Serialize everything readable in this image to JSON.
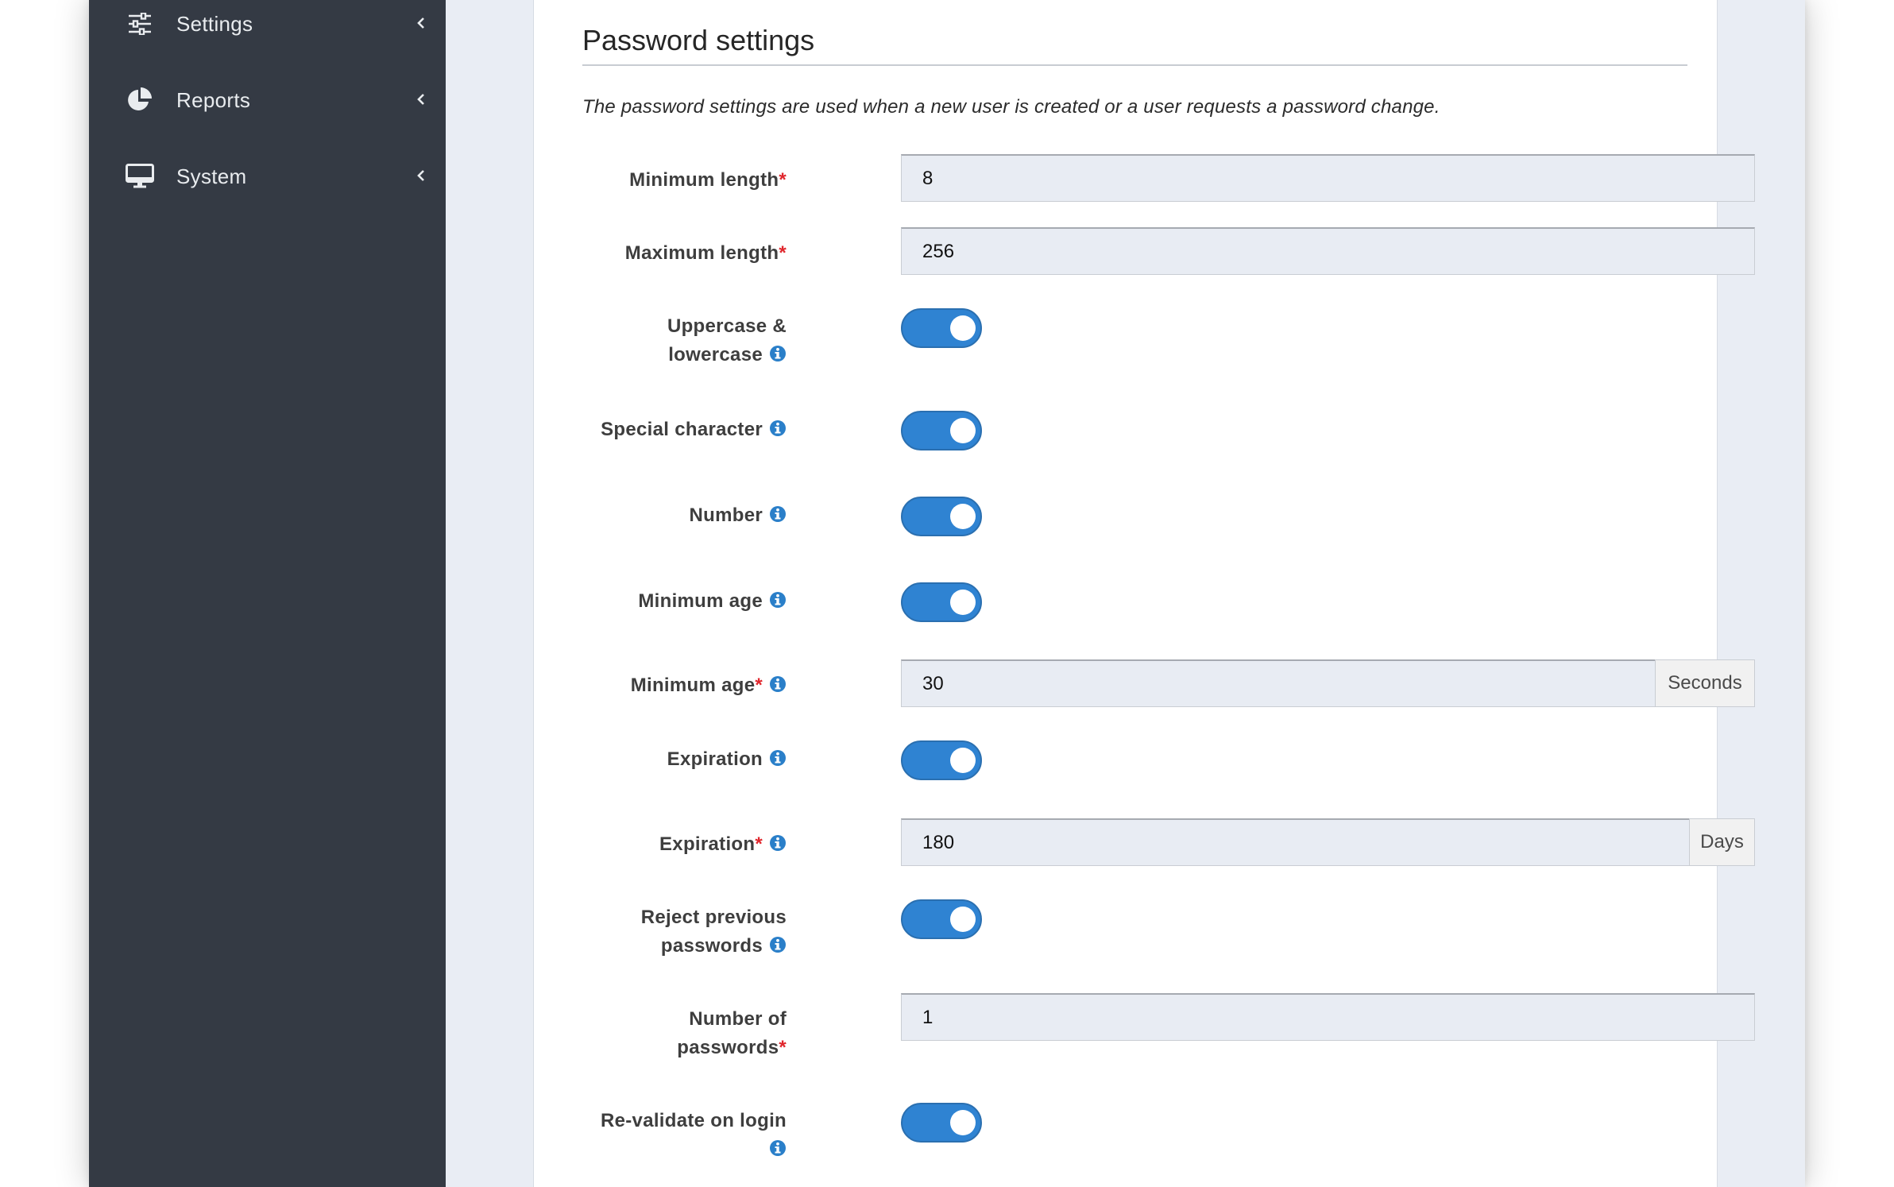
{
  "sidebar": {
    "items": [
      {
        "label": "Settings",
        "icon": "sliders-icon"
      },
      {
        "label": "Reports",
        "icon": "pie-chart-icon"
      },
      {
        "label": "System",
        "icon": "monitor-icon"
      }
    ]
  },
  "panel": {
    "title": "Password settings",
    "description": "The password settings are used when a new user is created or a user requests a password change."
  },
  "form": {
    "min_length": {
      "label": "Minimum length",
      "required": "*",
      "value": "8"
    },
    "max_length": {
      "label": "Maximum length",
      "required": "*",
      "value": "256"
    },
    "upper_lower": {
      "label_line1": "Uppercase &",
      "label_line2": "lowercase",
      "enabled": true
    },
    "special_char": {
      "label": "Special character",
      "enabled": true
    },
    "number": {
      "label": "Number",
      "enabled": true
    },
    "min_age_toggle": {
      "label": "Minimum age",
      "enabled": true
    },
    "min_age_value": {
      "label": "Minimum age",
      "required": "*",
      "value": "30",
      "unit": "Seconds"
    },
    "expiration_toggle": {
      "label": "Expiration",
      "enabled": true
    },
    "expiration_value": {
      "label": "Expiration",
      "required": "*",
      "value": "180",
      "unit": "Days"
    },
    "reject_previous": {
      "label_line1": "Reject previous",
      "label_line2": "passwords",
      "enabled": true
    },
    "number_of_passwords": {
      "label_line1": "Number of",
      "label_line2": "passwords",
      "required": "*",
      "value": "1"
    },
    "revalidate": {
      "label_line1": "Re-validate on login",
      "enabled": true
    }
  },
  "colors": {
    "sidebar_bg": "#343a44",
    "toggle_on": "#2f83d2",
    "required": "#e0262c",
    "info": "#2a7fc9"
  }
}
